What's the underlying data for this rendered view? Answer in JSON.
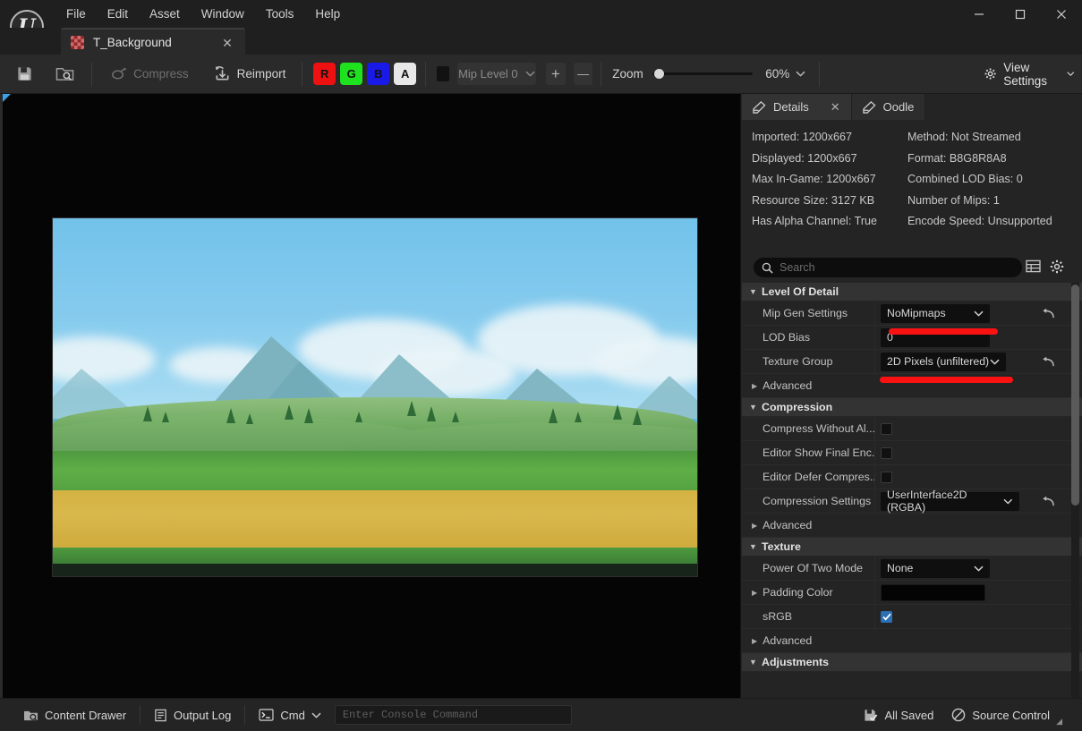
{
  "window": {
    "app_logo": "unreal-engine-logo",
    "minimize": "–",
    "maximize": "□",
    "close": "✕"
  },
  "menubar": {
    "items": [
      {
        "label": "File"
      },
      {
        "label": "Edit"
      },
      {
        "label": "Asset"
      },
      {
        "label": "Window"
      },
      {
        "label": "Tools"
      },
      {
        "label": "Help"
      }
    ]
  },
  "tab": {
    "label": "T_Background",
    "close": "✕",
    "icon": "texture-checker-icon"
  },
  "toolbar": {
    "save_icon": "save-icon",
    "browse_icon": "browse-content-icon",
    "compress_label": "Compress",
    "compress_icon": "compress-icon",
    "reimport_label": "Reimport",
    "reimport_icon": "reimport-icon",
    "channels": [
      {
        "label": "R",
        "color": "#ee1111",
        "text_color": "#111111"
      },
      {
        "label": "G",
        "color": "#1ee21e",
        "text_color": "#111111"
      },
      {
        "label": "B",
        "color": "#1919e8",
        "text_color": "#111111"
      },
      {
        "label": "A",
        "color": "#e8e8e8",
        "text_color": "#111111"
      }
    ],
    "mip_level_label": "Mip Level 0",
    "mip_plus": "+",
    "mip_minus": "—",
    "zoom_label": "Zoom",
    "zoom_value": "60%",
    "zoom_percent": 60,
    "view_settings_label": "View Settings",
    "view_settings_icon": "gear-icon"
  },
  "panel_tabs": [
    {
      "label": "Details",
      "icon": "details-icon",
      "active": true,
      "closable": true
    },
    {
      "label": "Oodle",
      "icon": "oodle-icon",
      "active": false,
      "closable": false
    }
  ],
  "details": {
    "left_column": [
      "Imported: 1200x667",
      "Displayed: 1200x667",
      "Max In-Game: 1200x667",
      "Resource Size: 3127 KB",
      "Has Alpha Channel: True"
    ],
    "right_column": [
      "Method: Not Streamed",
      "Format: B8G8R8A8",
      "Combined LOD Bias: 0",
      "Number of Mips: 1",
      "Encode Speed: Unsupported"
    ]
  },
  "search": {
    "placeholder": "Search",
    "value": "",
    "icon": "search-icon",
    "grid_view_icon": "grid-view-icon",
    "settings_icon": "gear-icon"
  },
  "properties": {
    "sections": [
      {
        "name": "Level Of Detail",
        "expanded": true,
        "rows": [
          {
            "label": "Mip Gen Settings",
            "type": "dropdown",
            "value": "NoMipmaps",
            "reset": true,
            "highlight": true
          },
          {
            "label": "LOD Bias",
            "type": "number",
            "value": "0",
            "reset": false,
            "highlight": false
          },
          {
            "label": "Texture Group",
            "type": "dropdown",
            "value": "2D Pixels (unfiltered)",
            "reset": true,
            "highlight": true
          }
        ],
        "advanced_label": "Advanced"
      },
      {
        "name": "Compression",
        "expanded": true,
        "rows": [
          {
            "label": "Compress Without Al...",
            "type": "checkbox",
            "checked": false,
            "reset": false,
            "highlight": false
          },
          {
            "label": "Editor Show Final Enc...",
            "type": "checkbox",
            "checked": false,
            "reset": false,
            "highlight": false
          },
          {
            "label": "Editor Defer Compres...",
            "type": "checkbox",
            "checked": false,
            "reset": false,
            "highlight": false
          },
          {
            "label": "Compression Settings",
            "type": "dropdown",
            "value": "UserInterface2D (RGBA)",
            "reset": true,
            "highlight": false
          }
        ],
        "advanced_label": "Advanced"
      },
      {
        "name": "Texture",
        "expanded": true,
        "rows": [
          {
            "label": "Power Of Two Mode",
            "type": "dropdown",
            "value": "None",
            "reset": false,
            "highlight": false
          },
          {
            "label": "Padding Color",
            "type": "color",
            "value": "#060606",
            "expandable": true,
            "reset": false,
            "highlight": false
          },
          {
            "label": "sRGB",
            "type": "checkbox",
            "checked": true,
            "reset": false,
            "highlight": false
          }
        ],
        "advanced_label": "Advanced"
      },
      {
        "name": "Adjustments",
        "expanded": true,
        "rows": [],
        "advanced_label": ""
      }
    ]
  },
  "statusbar": {
    "content_drawer_label": "Content Drawer",
    "content_drawer_icon": "content-drawer-icon",
    "output_log_label": "Output Log",
    "output_log_icon": "output-log-icon",
    "cmd_label": "Cmd",
    "cmd_icon": "console-prompt-icon",
    "console_placeholder": "Enter Console Command",
    "console_value": "",
    "all_saved_label": "All Saved",
    "all_saved_icon": "save-check-icon",
    "source_control_label": "Source Control",
    "source_control_icon": "no-entry-icon"
  },
  "colors": {
    "accent_red": "#fa1212",
    "checkbox_blue": "#2b6fb5",
    "panel_bg": "#242424",
    "toolbar_bg": "#2a2a2a",
    "viewport_bg": "#050505"
  }
}
